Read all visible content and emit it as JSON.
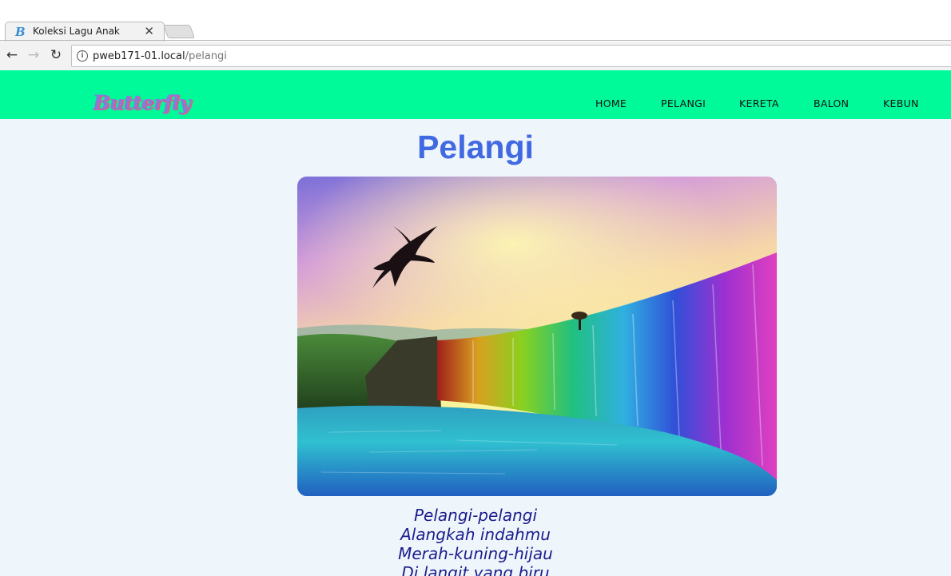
{
  "browser": {
    "tab_title": "Koleksi Lagu Anak",
    "favicon_letter": "B",
    "close_glyph": "✕",
    "url_host": "pweb171-01.local",
    "url_path": "/pelangi",
    "back_glyph": "←",
    "forward_glyph": "→",
    "reload_glyph": "↻",
    "info_glyph": "i"
  },
  "site": {
    "logo_text": "Butterfly",
    "nav": [
      "HOME",
      "PELANGI",
      "KERETA",
      "BALON",
      "KEBUN"
    ]
  },
  "main": {
    "title": "Pelangi",
    "lyrics": [
      "Pelangi-pelangi",
      "Alangkah indahmu",
      "Merah-kuning-hijau",
      "Di langit yang biru"
    ]
  },
  "colors": {
    "header_bg": "#00fa9a",
    "page_bg": "#eef6fc",
    "title": "#4169e1",
    "lyrics": "#1c1c8c"
  }
}
